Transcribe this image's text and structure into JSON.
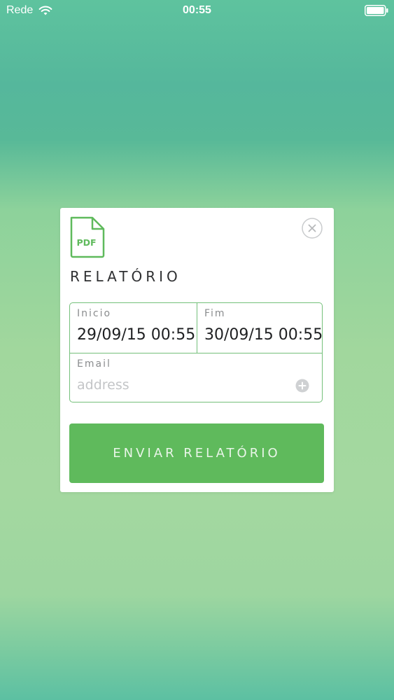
{
  "status_bar": {
    "carrier": "Rede",
    "time": "00:55",
    "icons": [
      "wifi-icon",
      "battery-icon"
    ]
  },
  "modal": {
    "icon": "pdf-icon",
    "icon_text": "PDF",
    "title": "RELATÓRIO",
    "close_icon": "close-icon",
    "start": {
      "label": "Inicio",
      "value": "29/09/15 00:55"
    },
    "end": {
      "label": "Fim",
      "value": "30/09/15 00:55"
    },
    "email": {
      "label": "Email",
      "value": "",
      "placeholder": "address",
      "add_icon": "plus-circle-icon"
    },
    "send_button": "ENVIAR RELATÓRIO"
  },
  "colors": {
    "accent_green": "#5fba5c",
    "border_green": "#74c07a",
    "background_top": "#5ec39e",
    "background_mid": "#a1d79d"
  }
}
